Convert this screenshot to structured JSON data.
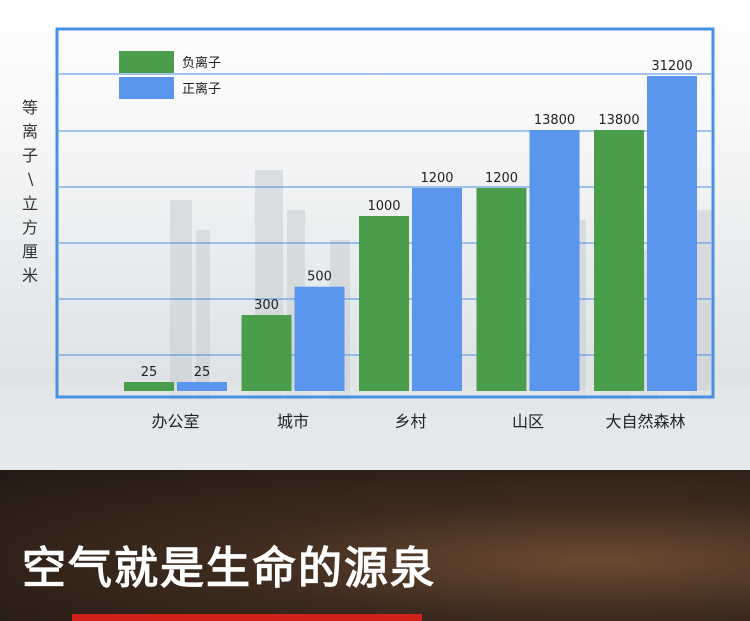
{
  "slogan": "空气就是生命的源泉",
  "chart_data": {
    "type": "bar",
    "ylabel": "等离子\\立方厘米",
    "categories": [
      "办公室",
      "城市",
      "乡村",
      "山区",
      "大自然森林"
    ],
    "series": [
      {
        "name": "负离子",
        "values": [
          25,
          300,
          1000,
          1200,
          13800
        ],
        "color": "#4a9d4a"
      },
      {
        "name": "正离子",
        "values": [
          25,
          500,
          1200,
          13800,
          31200
        ],
        "color": "#5a95ee"
      }
    ],
    "grid": true,
    "legend": "top-left"
  }
}
